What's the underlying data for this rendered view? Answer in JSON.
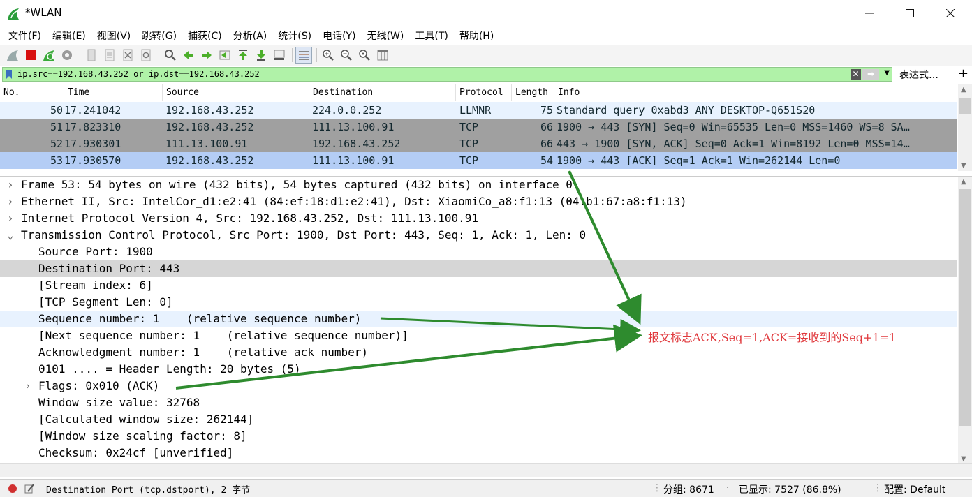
{
  "window": {
    "title": "*WLAN"
  },
  "menu": [
    "文件(F)",
    "编辑(E)",
    "视图(V)",
    "跳转(G)",
    "捕获(C)",
    "分析(A)",
    "统计(S)",
    "电话(Y)",
    "无线(W)",
    "工具(T)",
    "帮助(H)"
  ],
  "filter": {
    "value": "ip.src==192.168.43.252 or ip.dst==192.168.43.252",
    "expression_label": "表达式…",
    "add_label": "+"
  },
  "packet_list": {
    "columns": [
      "No.",
      "Time",
      "Source",
      "Destination",
      "Protocol",
      "Length",
      "Info"
    ],
    "rows": [
      {
        "no": "50",
        "time": "17.241042",
        "src": "192.168.43.252",
        "dst": "224.0.0.252",
        "proto": "LLMNR",
        "len": "75",
        "info": "Standard query 0xabd3 ANY DESKTOP-Q651S20",
        "bg": "#e8f2fe",
        "fg": "#12272e"
      },
      {
        "no": "51",
        "time": "17.823310",
        "src": "192.168.43.252",
        "dst": "111.13.100.91",
        "proto": "TCP",
        "len": "66",
        "info": "1900 → 443 [SYN] Seq=0 Win=65535 Len=0 MSS=1460 WS=8 SA…",
        "bg": "#a0a0a0",
        "fg": "#12272e"
      },
      {
        "no": "52",
        "time": "17.930301",
        "src": "111.13.100.91",
        "dst": "192.168.43.252",
        "proto": "TCP",
        "len": "66",
        "info": "443 → 1900 [SYN, ACK] Seq=0 Ack=1 Win=8192 Len=0 MSS=14…",
        "bg": "#a0a0a0",
        "fg": "#12272e"
      },
      {
        "no": "53",
        "time": "17.930570",
        "src": "192.168.43.252",
        "dst": "111.13.100.91",
        "proto": "TCP",
        "len": "54",
        "info": "1900 → 443 [ACK] Seq=1 Ack=1 Win=262144 Len=0",
        "bg": "#b4cdf5",
        "fg": "#12272e"
      }
    ]
  },
  "details": [
    {
      "text": "Frame 53: 54 bytes on wire (432 bits), 54 bytes captured (432 bits) on interface 0",
      "level": 0,
      "expander": "›",
      "bg": "#ffffff"
    },
    {
      "text": "Ethernet II, Src: IntelCor_d1:e2:41 (84:ef:18:d1:e2:41), Dst: XiaomiCo_a8:f1:13 (04:b1:67:a8:f1:13)",
      "level": 0,
      "expander": "›",
      "bg": "#ffffff"
    },
    {
      "text": "Internet Protocol Version 4, Src: 192.168.43.252, Dst: 111.13.100.91",
      "level": 0,
      "expander": "›",
      "bg": "#ffffff"
    },
    {
      "text": "Transmission Control Protocol, Src Port: 1900, Dst Port: 443, Seq: 1, Ack: 1, Len: 0",
      "level": 0,
      "expander": "⌄",
      "bg": "#ffffff"
    },
    {
      "text": "Source Port: 1900",
      "level": 1,
      "expander": "",
      "bg": "#ffffff"
    },
    {
      "text": "Destination Port: 443",
      "level": 1,
      "expander": "",
      "bg": "#d6d6d6"
    },
    {
      "text": "[Stream index: 6]",
      "level": 1,
      "expander": "",
      "bg": "#ffffff"
    },
    {
      "text": "[TCP Segment Len: 0]",
      "level": 1,
      "expander": "",
      "bg": "#ffffff"
    },
    {
      "text": "Sequence number: 1    (relative sequence number)",
      "level": 1,
      "expander": "",
      "bg": "#e8f2fe"
    },
    {
      "text": "[Next sequence number: 1    (relative sequence number)]",
      "level": 1,
      "expander": "",
      "bg": "#ffffff"
    },
    {
      "text": "Acknowledgment number: 1    (relative ack number)",
      "level": 1,
      "expander": "",
      "bg": "#ffffff"
    },
    {
      "text": "0101 .... = Header Length: 20 bytes (5)",
      "level": 1,
      "expander": "",
      "bg": "#ffffff"
    },
    {
      "text": "Flags: 0x010 (ACK)",
      "level": 1,
      "expander": "›",
      "bg": "#ffffff"
    },
    {
      "text": "Window size value: 32768",
      "level": 1,
      "expander": "",
      "bg": "#ffffff"
    },
    {
      "text": "[Calculated window size: 262144]",
      "level": 1,
      "expander": "",
      "bg": "#ffffff"
    },
    {
      "text": "[Window size scaling factor: 8]",
      "level": 1,
      "expander": "",
      "bg": "#ffffff"
    },
    {
      "text": "Checksum: 0x24cf [unverified]",
      "level": 1,
      "expander": "",
      "bg": "#ffffff"
    }
  ],
  "annotation": {
    "text": "报文标志ACK,Seq=1,ACK=接收到的Seq+1=1",
    "color": "#e0393d",
    "arrow_color": "#2e8b2e"
  },
  "status": {
    "field_text": "Destination Port (tcp.dstport), 2 字节",
    "packets": "分组: 8671",
    "displayed": "已显示: 7527 (86.8%)",
    "profile": "配置: Default"
  }
}
